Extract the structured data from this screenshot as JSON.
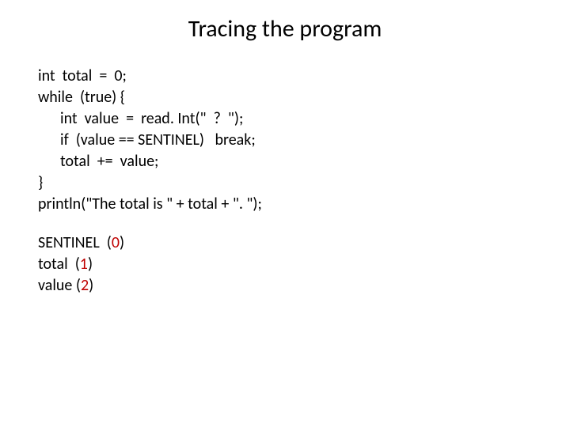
{
  "title": "Tracing the program",
  "code": {
    "l1": "int  total  =  0;",
    "l2": "while  (true) {",
    "l3": "int  value  =  read. Int(\"  ?  \");",
    "l4": "if  (value == SENTINEL)   break;",
    "l5": "total  +=  value;",
    "l6": "}",
    "l7": "println(\"The total is \" + total + \". \");"
  },
  "trace": {
    "t1_pre": "SENTINEL  (",
    "t1_val": "0",
    "t1_post": ")",
    "t2_pre": "total  (",
    "t2_val": "1",
    "t2_post": ")",
    "t3_pre": "value (",
    "t3_val": "2",
    "t3_post": ")"
  }
}
